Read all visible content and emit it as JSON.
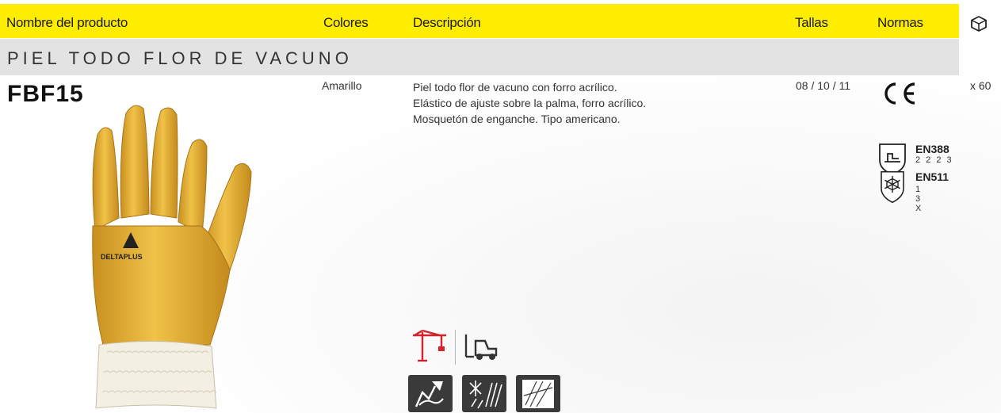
{
  "header": {
    "product_name": "Nombre del producto",
    "colors": "Colores",
    "description": "Descripción",
    "sizes": "Tallas",
    "norms": "Normas",
    "packaging_icon": "box-icon"
  },
  "section": {
    "title": "PIEL TODO FLOR DE VACUNO"
  },
  "product": {
    "code": "FBF15",
    "color": "Amarillo",
    "description": [
      "Piel todo flor de vacuno con forro acrílico.",
      "Elástico de ajuste sobre la palma, forro acrílico.",
      "Mosquetón de enganche.  Tipo americano."
    ],
    "sizes": "08 / 10 / 11",
    "quantity": "x 60",
    "brand_logo_text": "DELTAPLUS",
    "image_icon": "yellow-leather-glove"
  },
  "norms": [
    {
      "code": "EN388",
      "levels": "2 2 2 3",
      "icon": "mechanical-risk-shield-icon"
    },
    {
      "code": "EN511",
      "levels": [
        "1",
        "3",
        "X"
      ],
      "icon": "cold-risk-shield-icon"
    }
  ],
  "ce_mark": "CE",
  "usage_icons": [
    "crane-icon",
    "forklift-icon"
  ],
  "risk_icons": [
    "hand-mechanical-icon",
    "cold-conditions-icon",
    "abrasion-icon"
  ],
  "colors": {
    "header_bg": "#ffed00",
    "section_bg": "#e3e3e3",
    "accent_red": "#d2232a",
    "glove": "#e8b43a"
  }
}
